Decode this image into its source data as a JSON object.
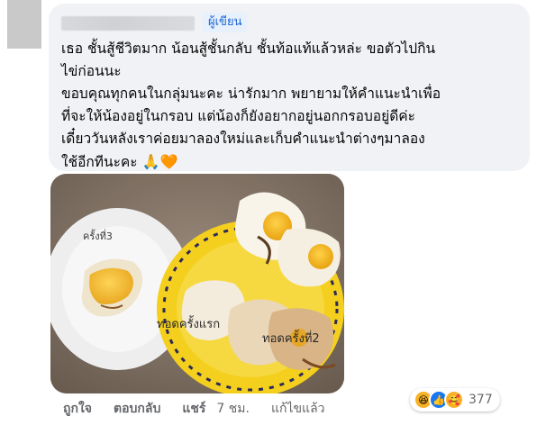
{
  "comment": {
    "author_badge": "ผู้เขียน",
    "text": "เธอ ชั้นสู้ชีวิตมาก น้อนสู้ชั้นกลับ ชั้นท้อแท้แล้วหล่ะ ขอตัวไปกิน\nไข่ก่อนนะ\nขอบคุณทุกคนในกลุ่มนะคะ น่ารักมาก พยายามให้คำแนะนำเพื่อ\nที่จะให้น้องอยู่ในกรอบ แต่น้องก็ยังอยากอยู่นอกกรอบอยู่ดีค่ะ\nเดี๋ยววันหลังเราค่อยมาลองใหม่และเก็บคำแนะนำต่างๆมาลอง\nใช้อีกทีนะคะ",
    "emojis": "🙏🧡"
  },
  "photo": {
    "labels": {
      "third": "ครั้งที่3",
      "first": "ทอดครั้งแรก",
      "second": "ทอดครั้งที่2"
    }
  },
  "actions": {
    "like": "ถูกใจ",
    "reply": "ตอบกลับ",
    "share": "แชร์",
    "time": "7 ชม.",
    "edited": "แก้ไขแล้ว"
  },
  "reactions": {
    "icons": [
      "haha-icon",
      "like-icon",
      "care-icon"
    ],
    "count": "377"
  }
}
